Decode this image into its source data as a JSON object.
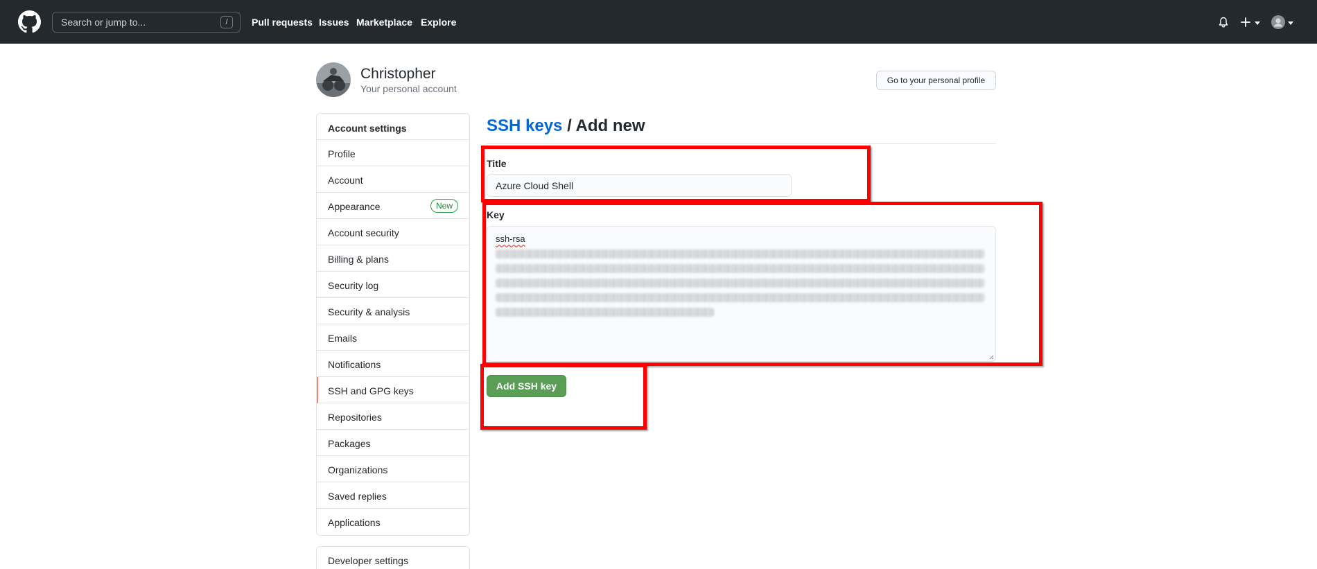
{
  "header": {
    "search_placeholder": "Search or jump to...",
    "search_shortcut": "/",
    "nav": [
      "Pull requests",
      "Issues",
      "Marketplace",
      "Explore"
    ],
    "plus_label": "+"
  },
  "account": {
    "name": "Christopher",
    "subtitle": "Your personal account",
    "profile_button": "Go to your personal profile"
  },
  "sidebar": {
    "heading": "Account settings",
    "items": [
      {
        "label": "Profile"
      },
      {
        "label": "Account"
      },
      {
        "label": "Appearance",
        "badge": "New"
      },
      {
        "label": "Account security"
      },
      {
        "label": "Billing & plans"
      },
      {
        "label": "Security log"
      },
      {
        "label": "Security & analysis"
      },
      {
        "label": "Emails"
      },
      {
        "label": "Notifications"
      },
      {
        "label": "SSH and GPG keys",
        "active": true
      },
      {
        "label": "Repositories"
      },
      {
        "label": "Packages"
      },
      {
        "label": "Organizations"
      },
      {
        "label": "Saved replies"
      },
      {
        "label": "Applications"
      }
    ],
    "developer": "Developer settings"
  },
  "main": {
    "breadcrumb_link": "SSH keys",
    "breadcrumb_separator": " / ",
    "breadcrumb_current": "Add new",
    "title_label": "Title",
    "title_value": "Azure Cloud Shell",
    "key_label": "Key",
    "key_prefix": "ssh-rsa",
    "submit": "Add SSH key"
  },
  "colors": {
    "header_bg": "#24292e",
    "link": "#0366d6",
    "button_green": "#5a9e55",
    "annotation": "#ff0000",
    "active_marker": "#f9826c"
  },
  "icons": [
    "github-logo-icon",
    "bell-icon",
    "plus-icon",
    "avatar-icon",
    "caret-down-icon"
  ]
}
